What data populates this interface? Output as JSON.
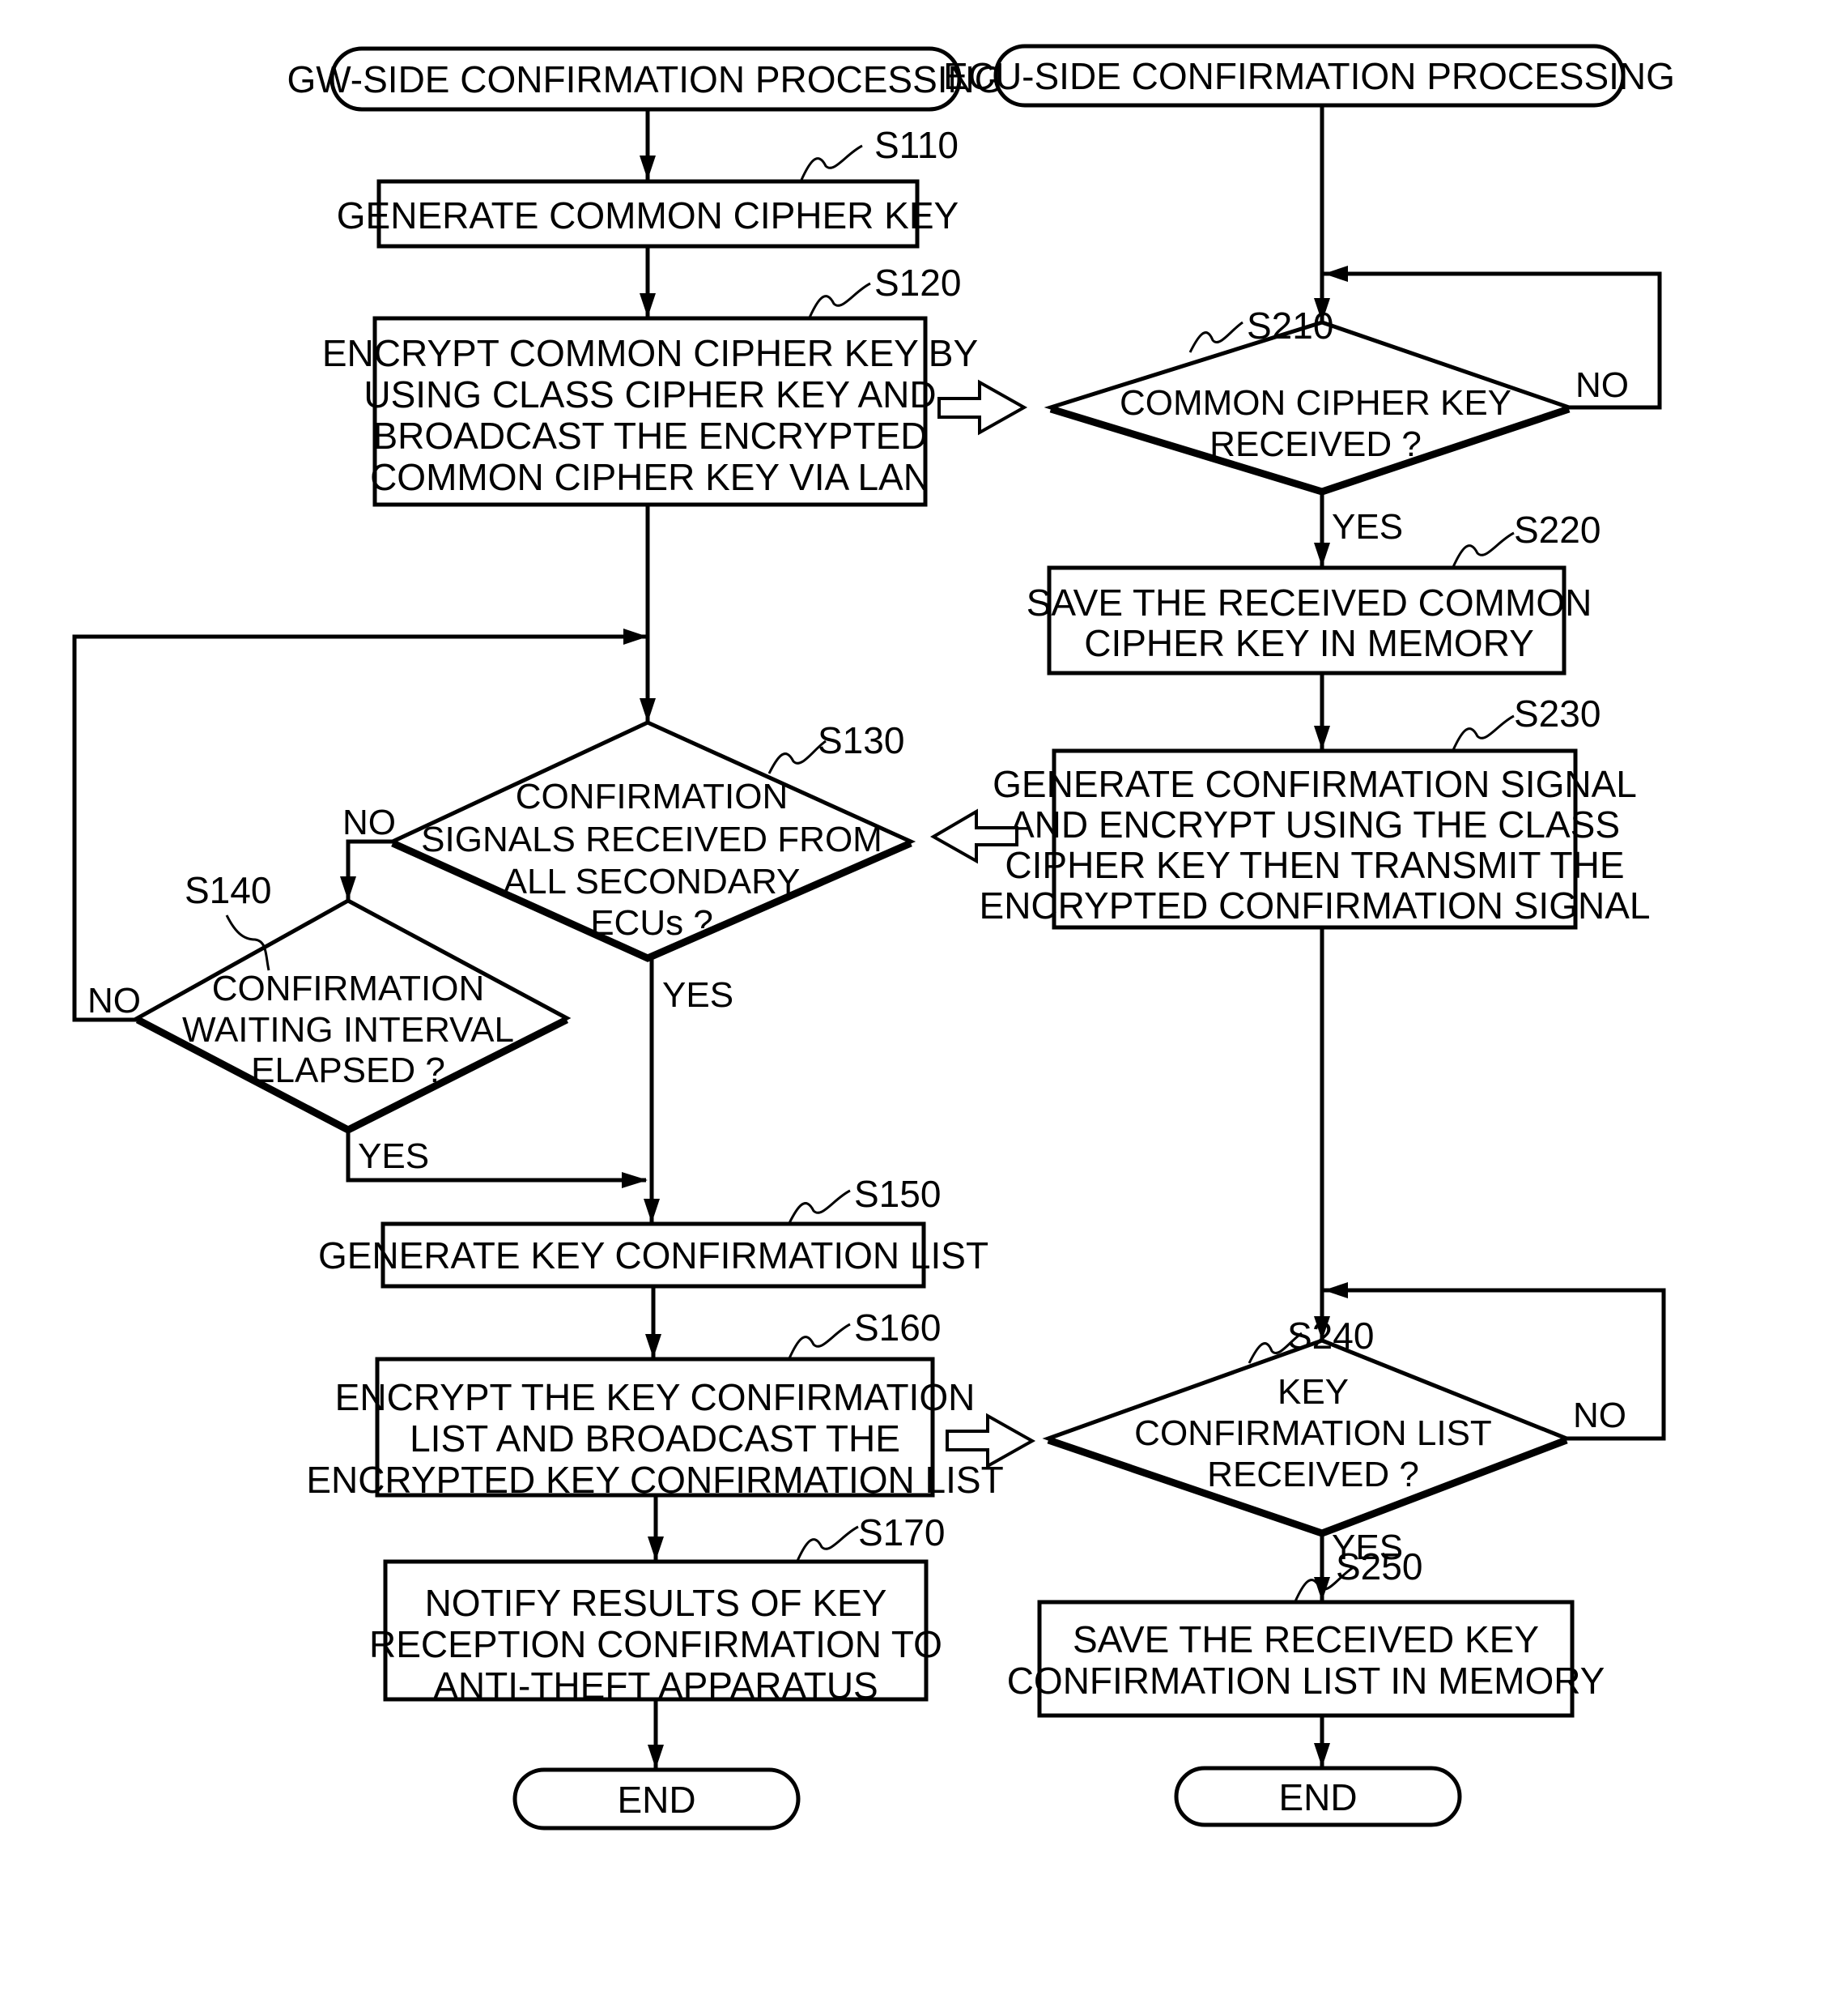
{
  "figure": {
    "gw": {
      "title": "GW-SIDE CONFIRMATION PROCESSING",
      "steps": {
        "s110": {
          "id": "S110",
          "lines": [
            "GENERATE COMMON CIPHER KEY"
          ]
        },
        "s120": {
          "id": "S120",
          "lines": [
            "ENCRYPT COMMON CIPHER KEY BY",
            "USING CLASS CIPHER KEY AND",
            "BROADCAST THE ENCRYPTED",
            "COMMON CIPHER KEY VIA LAN"
          ]
        },
        "s130": {
          "id": "S130",
          "lines": [
            "CONFIRMATION",
            "SIGNALS RECEIVED FROM",
            "ALL SECONDARY",
            "ECUs ?"
          ],
          "yes": "YES",
          "no": "NO"
        },
        "s140": {
          "id": "S140",
          "lines": [
            "CONFIRMATION",
            "WAITING INTERVAL",
            "ELAPSED ?"
          ],
          "yes": "YES",
          "no": "NO"
        },
        "s150": {
          "id": "S150",
          "lines": [
            "GENERATE KEY CONFIRMATION LIST"
          ]
        },
        "s160": {
          "id": "S160",
          "lines": [
            "ENCRYPT THE KEY CONFIRMATION",
            "LIST AND BROADCAST THE",
            "ENCRYPTED KEY CONFIRMATION LIST"
          ]
        },
        "s170": {
          "id": "S170",
          "lines": [
            "NOTIFY RESULTS OF KEY",
            "RECEPTION CONFIRMATION TO",
            "ANTI-THEFT APPARATUS"
          ]
        }
      },
      "end": "END"
    },
    "ecu": {
      "title": "ECU-SIDE CONFIRMATION PROCESSING",
      "steps": {
        "s210": {
          "id": "S210",
          "lines": [
            "COMMON CIPHER KEY",
            "RECEIVED ?"
          ],
          "yes": "YES",
          "no": "NO"
        },
        "s220": {
          "id": "S220",
          "lines": [
            "SAVE THE RECEIVED COMMON",
            "CIPHER KEY IN MEMORY"
          ]
        },
        "s230": {
          "id": "S230",
          "lines": [
            "GENERATE CONFIRMATION SIGNAL",
            "AND ENCRYPT USING THE CLASS",
            "CIPHER KEY THEN TRANSMIT THE",
            "ENCRYPTED CONFIRMATION SIGNAL"
          ]
        },
        "s240": {
          "id": "S240",
          "lines": [
            "KEY",
            "CONFIRMATION LIST",
            "RECEIVED ?"
          ],
          "yes": "YES",
          "no": "NO"
        },
        "s250": {
          "id": "S250",
          "lines": [
            "SAVE THE RECEIVED KEY",
            "CONFIRMATION LIST IN MEMORY"
          ]
        }
      },
      "end": "END"
    }
  }
}
